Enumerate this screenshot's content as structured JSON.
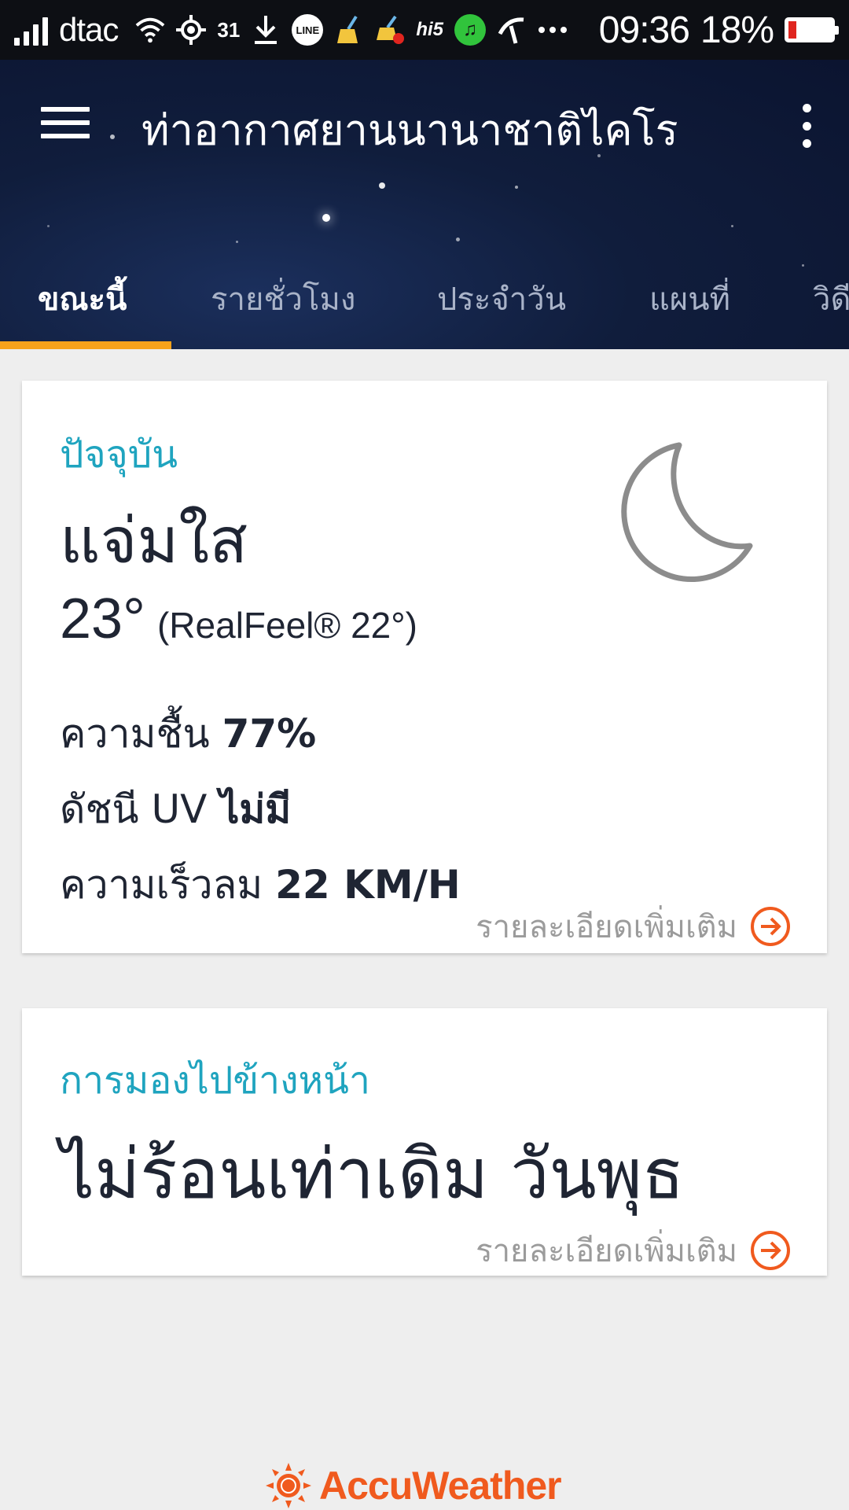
{
  "status_bar": {
    "carrier": "dtac",
    "temp_badge": "31",
    "line_badge": "LINE",
    "hi5_label": "hi5",
    "time": "09:36",
    "battery_percent": "18%",
    "battery_level": 0.18
  },
  "header": {
    "title": "ท่าอากาศยานนานาชาติไคโร",
    "tabs": [
      {
        "label": "ขณะนี้",
        "active": true
      },
      {
        "label": "รายชั่วโมง",
        "active": false
      },
      {
        "label": "ประจำวัน",
        "active": false
      },
      {
        "label": "แผนที่",
        "active": false
      },
      {
        "label": "วิดี",
        "active": false
      }
    ],
    "accent_color": "#f7a21b"
  },
  "current": {
    "section_label": "ปัจจุบัน",
    "condition": "แจ่มใส",
    "temperature": "23°",
    "realfeel": "(RealFeel® 22°)",
    "icon": "moon-icon",
    "humidity_label": "ความชื้น",
    "humidity_value": "77%",
    "uv_label": "ดัชนี UV",
    "uv_value": "ไม่มี",
    "wind_label": "ความเร็วลม",
    "wind_value": "22 KM/H",
    "more_label": "รายละเอียดเพิ่มเติม"
  },
  "outlook": {
    "section_label": "การมองไปข้างหน้า",
    "text": "ไม่ร้อนเท่าเดิม วันพุธ",
    "more_label": "รายละเอียดเพิ่มเติม"
  },
  "footer": {
    "logo_text": "AccuWeather",
    "brand_color": "#f05a1e"
  }
}
